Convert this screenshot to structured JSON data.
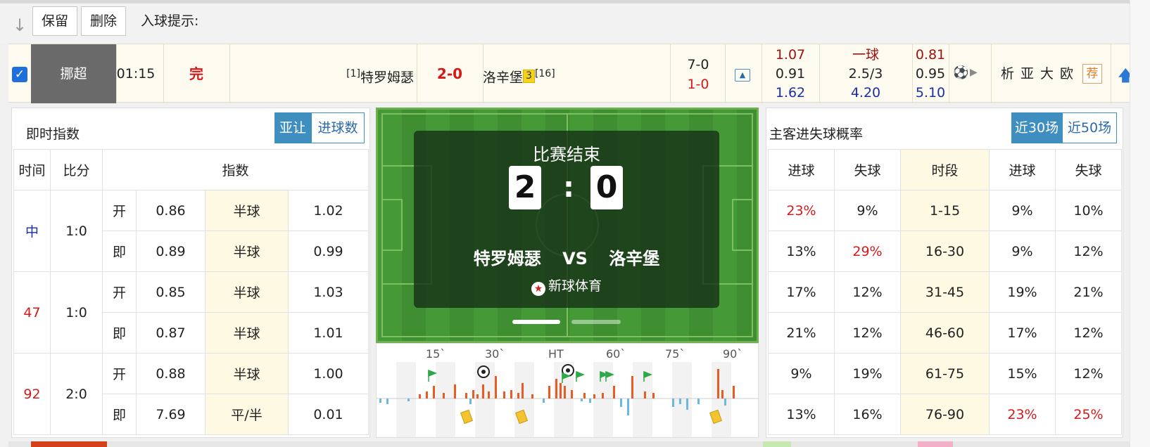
{
  "toolbar": {
    "keep": "保留",
    "delete": "删除",
    "hint": "入球提示:"
  },
  "match": {
    "checked": "✓",
    "league": "挪超",
    "time": "01:15",
    "status": "完",
    "home_rank": "[1]",
    "home": "特罗姆瑟",
    "score": "2-0",
    "away": "洛辛堡",
    "away_yellow": "3",
    "away_rank": "[16]",
    "half_corner": "7-0",
    "half_score": "1-0",
    "odds_home": [
      "1.07",
      "0.91",
      "1.62"
    ],
    "odds_mid": [
      "一球",
      "2.5/3",
      "4.20"
    ],
    "odds_away": [
      "0.81",
      "0.95",
      "5.10"
    ],
    "links": [
      "析",
      "亚",
      "大",
      "欧"
    ],
    "recommend": "荐"
  },
  "live_odds": {
    "title": "即时指数",
    "tabs": [
      "亚让",
      "进球数"
    ],
    "headers": [
      "时间",
      "比分",
      "指数"
    ],
    "groups": [
      {
        "minute": "中",
        "score": "1:0",
        "rows": [
          {
            "kind": "开",
            "home": "0.86",
            "line": "半球",
            "away": "1.02"
          },
          {
            "kind": "即",
            "home": "0.89",
            "line": "半球",
            "away": "0.99"
          }
        ]
      },
      {
        "minute": "47",
        "score": "1:0",
        "rows": [
          {
            "kind": "开",
            "home": "0.85",
            "line": "半球",
            "away": "1.03"
          },
          {
            "kind": "即",
            "home": "0.87",
            "line": "半球",
            "away": "1.01"
          }
        ]
      },
      {
        "minute": "92",
        "score": "2:0",
        "rows": [
          {
            "kind": "开",
            "home": "0.88",
            "line": "半球",
            "away": "1.00"
          },
          {
            "kind": "即",
            "home": "7.69",
            "line": "平/半",
            "away": "0.01"
          }
        ]
      }
    ]
  },
  "pitch": {
    "status": "比赛结束",
    "home_score": "2",
    "away_score": "0",
    "colon": ":",
    "home": "特罗姆瑟",
    "vs": "VS",
    "away": "洛辛堡",
    "brand": "新球体育"
  },
  "timeline": {
    "ticks": [
      "15`",
      "30`",
      "HT",
      "60`",
      "75`",
      "90`"
    ]
  },
  "probability": {
    "title": "主客进失球概率",
    "tabs": [
      "近30场",
      "近50场"
    ],
    "headers": [
      "进球",
      "失球",
      "时段",
      "进球",
      "失球"
    ],
    "rows": [
      [
        "23%",
        "9%",
        "1-15",
        "9%",
        "10%"
      ],
      [
        "13%",
        "29%",
        "16-30",
        "9%",
        "12%"
      ],
      [
        "17%",
        "12%",
        "31-45",
        "19%",
        "21%"
      ],
      [
        "21%",
        "12%",
        "46-60",
        "17%",
        "12%"
      ],
      [
        "9%",
        "19%",
        "61-75",
        "15%",
        "12%"
      ],
      [
        "13%",
        "16%",
        "76-90",
        "23%",
        "25%"
      ]
    ],
    "highlight_color": "#d41a1a"
  },
  "colors": {
    "accent_blue": "#3f8ec0",
    "live_red": "#d41a1a",
    "pitch_green": "#3f8f32"
  }
}
